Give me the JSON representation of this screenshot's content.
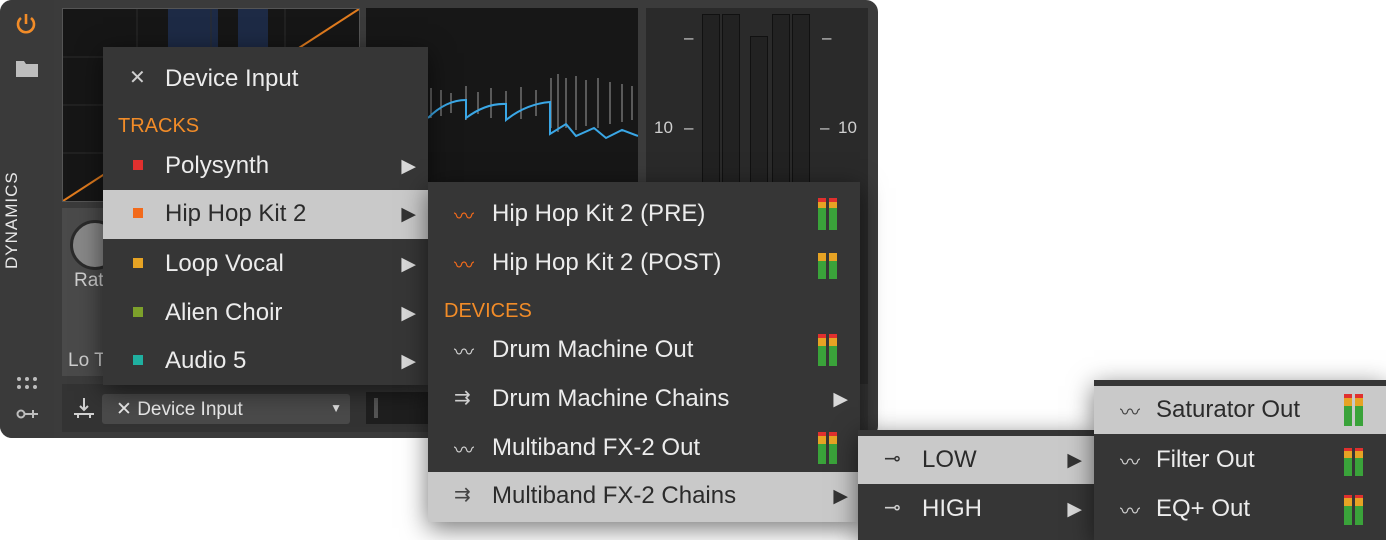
{
  "device": {
    "strip_label": "DYNAMICS",
    "ratio_label": "Rat",
    "lo_label": "Lo T",
    "input_select": "✕ Device Input",
    "meter_scale_left": "10",
    "meter_scale_right": "10",
    "meter_dash": "–"
  },
  "menu_main": {
    "header": "Device Input",
    "section": "TRACKS",
    "items": [
      {
        "label": "Polysynth",
        "color": "#e0302e"
      },
      {
        "label": "Hip Hop Kit 2",
        "color": "#f26a1b"
      },
      {
        "label": "Loop Vocal",
        "color": "#e6a324"
      },
      {
        "label": "Alien Choir",
        "color": "#7da12b"
      },
      {
        "label": "Audio 5",
        "color": "#1fb0a0"
      }
    ]
  },
  "menu_sub": {
    "tracks": [
      "Hip Hop Kit 2 (PRE)",
      "Hip Hop Kit 2 (POST)"
    ],
    "section": "DEVICES",
    "devices": [
      "Drum Machine Out",
      "Drum Machine Chains",
      "Multiband FX-2 Out",
      "Multiband FX-2 Chains"
    ]
  },
  "menu_bands": {
    "items": [
      "LOW",
      "HIGH"
    ]
  },
  "menu_outs": {
    "items": [
      "Saturator Out",
      "Filter Out",
      "EQ+ Out"
    ]
  },
  "colors": {
    "accent": "#f28c28",
    "menu_bg": "#363636",
    "highlight": "#c9c9c9"
  }
}
